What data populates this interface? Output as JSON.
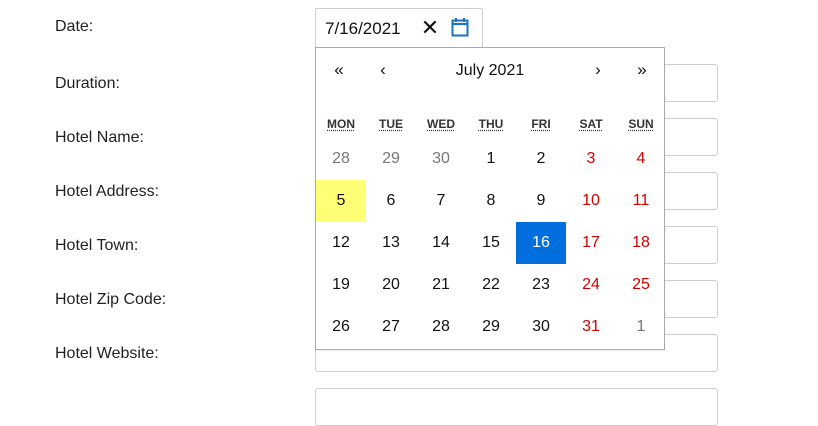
{
  "form": {
    "labels": {
      "date": "Date:",
      "duration": "Duration:",
      "hotel_name": "Hotel Name:",
      "hotel_address": "Hotel Address:",
      "hotel_town": "Hotel Town:",
      "hotel_zip": "Hotel Zip Code:",
      "hotel_website": "Hotel Website:"
    },
    "date_value": "7/16/2021",
    "clear_symbol": "✕"
  },
  "calendar": {
    "nav": {
      "prev_year": "«",
      "prev_month": "‹",
      "next_month": "›",
      "next_year": "»"
    },
    "month_label": "July 2021",
    "weekdays": [
      "MON",
      "TUE",
      "WED",
      "THU",
      "FRI",
      "SAT",
      "SUN"
    ],
    "weeks": [
      [
        "28",
        "29",
        "30",
        "1",
        "2",
        "3",
        "4"
      ],
      [
        "5",
        "6",
        "7",
        "8",
        "9",
        "10",
        "11"
      ],
      [
        "12",
        "13",
        "14",
        "15",
        "16",
        "17",
        "18"
      ],
      [
        "19",
        "20",
        "21",
        "22",
        "23",
        "24",
        "25"
      ],
      [
        "26",
        "27",
        "28",
        "29",
        "30",
        "31",
        "1"
      ]
    ],
    "today": "5",
    "selected": "16",
    "colors": {
      "selected_bg": "#006edc",
      "today_bg": "#ffff76",
      "weekend": "#d10000",
      "neighboring_month": "#777777"
    }
  }
}
